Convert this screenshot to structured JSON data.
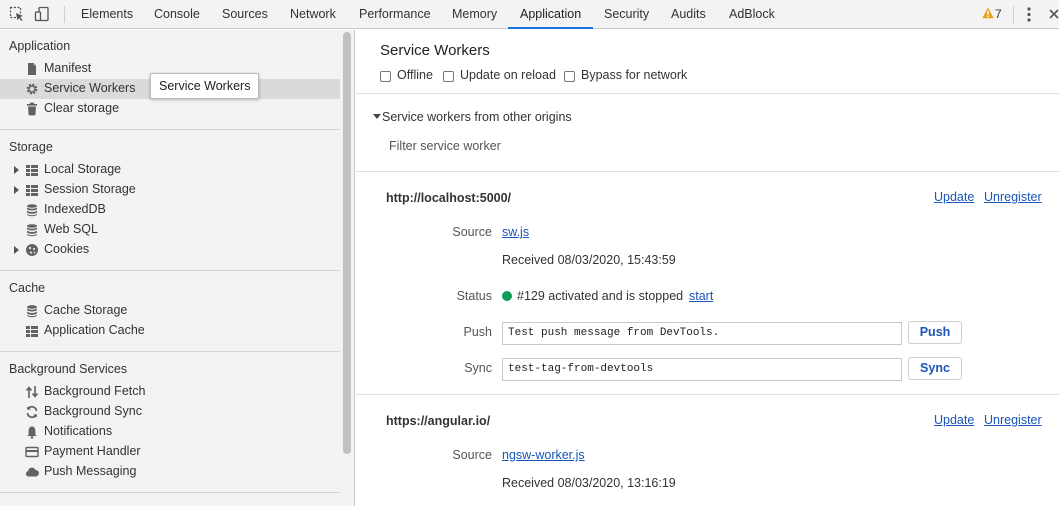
{
  "toolbar": {
    "tabs": [
      "Elements",
      "Console",
      "Sources",
      "Network",
      "Performance",
      "Memory",
      "Application",
      "Security",
      "Audits",
      "AdBlock"
    ],
    "active_tab": "Application",
    "warning_count": "7",
    "icons": [
      "inspect-element-icon",
      "device-toolbar-icon",
      "warning-icon",
      "more-options-icon",
      "close-icon"
    ]
  },
  "sidebar": {
    "application": {
      "title": "Application",
      "items": [
        {
          "label": "Manifest",
          "icon": "document-icon"
        },
        {
          "label": "Service Workers",
          "icon": "gear-icon",
          "selected": true
        },
        {
          "label": "Clear storage",
          "icon": "trash-icon"
        }
      ]
    },
    "storage": {
      "title": "Storage",
      "items": [
        {
          "label": "Local Storage",
          "icon": "grid-icon",
          "expandable": true
        },
        {
          "label": "Session Storage",
          "icon": "grid-icon",
          "expandable": true
        },
        {
          "label": "IndexedDB",
          "icon": "database-icon"
        },
        {
          "label": "Web SQL",
          "icon": "database-icon"
        },
        {
          "label": "Cookies",
          "icon": "cookie-icon",
          "expandable": true
        }
      ]
    },
    "cache": {
      "title": "Cache",
      "items": [
        {
          "label": "Cache Storage",
          "icon": "database-icon"
        },
        {
          "label": "Application Cache",
          "icon": "grid-icon"
        }
      ]
    },
    "background": {
      "title": "Background Services",
      "items": [
        {
          "label": "Background Fetch",
          "icon": "arrows-updown-icon"
        },
        {
          "label": "Background Sync",
          "icon": "sync-icon"
        },
        {
          "label": "Notifications",
          "icon": "bell-icon"
        },
        {
          "label": "Payment Handler",
          "icon": "card-icon"
        },
        {
          "label": "Push Messaging",
          "icon": "cloud-icon"
        }
      ]
    },
    "tooltip": "Service Workers"
  },
  "main": {
    "title": "Service Workers",
    "options": [
      {
        "label": "Offline",
        "checked": false
      },
      {
        "label": "Update on reload",
        "checked": false
      },
      {
        "label": "Bypass for network",
        "checked": false
      }
    ],
    "other_origins_label": "Service workers from other origins",
    "filter_placeholder": "Filter service worker",
    "workers": [
      {
        "origin": "http://localhost:5000/",
        "update_label": "Update",
        "unregister_label": "Unregister",
        "source_label": "Source",
        "source_file": "sw.js",
        "received": "Received 08/03/2020, 15:43:59",
        "status_label": "Status",
        "status_text": "#129 activated and is stopped",
        "status_action": "start",
        "status_color": "#0f9d58",
        "push_label": "Push",
        "push_value": "Test push message from DevTools.",
        "push_button": "Push",
        "sync_label": "Sync",
        "sync_value": "test-tag-from-devtools",
        "sync_button": "Sync"
      },
      {
        "origin": "https://angular.io/",
        "update_label": "Update",
        "unregister_label": "Unregister",
        "source_label": "Source",
        "source_file": "ngsw-worker.js",
        "received": "Received 08/03/2020, 13:16:19"
      }
    ]
  },
  "colors": {
    "accent": "#1a73e8",
    "link": "#1a55b8",
    "warning": "#e8a317",
    "status_active": "#0f9d58"
  }
}
